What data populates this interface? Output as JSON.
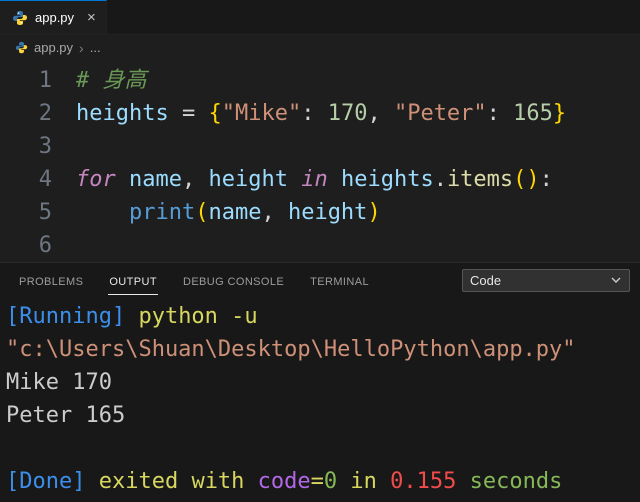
{
  "tabbar": {
    "tab": {
      "label": "app.py",
      "close": "×"
    }
  },
  "breadcrumb": {
    "file": "app.py",
    "sep": "›",
    "more": "..."
  },
  "editor": {
    "lines": [
      {
        "num": "1",
        "segments": [
          {
            "t": "# 身高",
            "c": "comment"
          }
        ]
      },
      {
        "num": "2",
        "segments": [
          {
            "t": "heights",
            "c": "var"
          },
          {
            "t": " = ",
            "c": "plain"
          },
          {
            "t": "{",
            "c": "brace"
          },
          {
            "t": "\"Mike\"",
            "c": "string"
          },
          {
            "t": ": ",
            "c": "plain"
          },
          {
            "t": "170",
            "c": "number"
          },
          {
            "t": ", ",
            "c": "plain"
          },
          {
            "t": "\"Peter\"",
            "c": "string"
          },
          {
            "t": ": ",
            "c": "plain"
          },
          {
            "t": "165",
            "c": "number"
          },
          {
            "t": "}",
            "c": "brace"
          }
        ]
      },
      {
        "num": "3",
        "segments": []
      },
      {
        "num": "4",
        "segments": [
          {
            "t": "for",
            "c": "keyword"
          },
          {
            "t": " ",
            "c": "plain"
          },
          {
            "t": "name",
            "c": "var"
          },
          {
            "t": ", ",
            "c": "plain"
          },
          {
            "t": "height",
            "c": "var"
          },
          {
            "t": " ",
            "c": "plain"
          },
          {
            "t": "in",
            "c": "keyword"
          },
          {
            "t": " ",
            "c": "plain"
          },
          {
            "t": "heights",
            "c": "var"
          },
          {
            "t": ".",
            "c": "plain"
          },
          {
            "t": "items",
            "c": "func"
          },
          {
            "t": "()",
            "c": "brace"
          },
          {
            "t": ":",
            "c": "plain"
          }
        ]
      },
      {
        "num": "5",
        "segments": [
          {
            "t": "    ",
            "c": "plain"
          },
          {
            "t": "print",
            "c": "builtin"
          },
          {
            "t": "(",
            "c": "brace"
          },
          {
            "t": "name",
            "c": "var"
          },
          {
            "t": ", ",
            "c": "plain"
          },
          {
            "t": "height",
            "c": "var"
          },
          {
            "t": ")",
            "c": "brace"
          }
        ]
      },
      {
        "num": "6",
        "segments": []
      }
    ]
  },
  "panel": {
    "tabs": [
      {
        "label": "PROBLEMS",
        "active": false
      },
      {
        "label": "OUTPUT",
        "active": true
      },
      {
        "label": "DEBUG CONSOLE",
        "active": false
      },
      {
        "label": "TERMINAL",
        "active": false
      }
    ],
    "dropdown": {
      "value": "Code"
    },
    "output_lines": [
      {
        "segments": [
          {
            "t": "[Running] ",
            "c": "blue"
          },
          {
            "t": "python -u",
            "c": "yellow"
          }
        ]
      },
      {
        "segments": [
          {
            "t": "\"c:\\Users\\Shuan\\Desktop\\HelloPython\\app.py\"",
            "c": "orange"
          }
        ]
      },
      {
        "segments": [
          {
            "t": "Mike 170",
            "c": "white"
          }
        ]
      },
      {
        "segments": [
          {
            "t": "Peter 165",
            "c": "white"
          }
        ]
      },
      {
        "segments": []
      },
      {
        "segments": [
          {
            "t": "[Done]",
            "c": "blue"
          },
          {
            "t": " exited with ",
            "c": "yellow"
          },
          {
            "t": "code",
            "c": "magenta"
          },
          {
            "t": "=",
            "c": "yellow"
          },
          {
            "t": "0",
            "c": "green"
          },
          {
            "t": " in ",
            "c": "yellow"
          },
          {
            "t": "0.155",
            "c": "red"
          },
          {
            "t": " seconds",
            "c": "green"
          }
        ]
      }
    ]
  },
  "colors": {
    "editor_background": "#1e1e1e",
    "panel_background": "#181818",
    "tab_bar_background": "#181818",
    "active_tab_accent": "#0078d4",
    "comment_green": "#6a9955",
    "string_orange": "#ce9178",
    "number_green": "#b5cea8",
    "keyword_purple": "#c586c0",
    "variable_blue": "#9cdcfe",
    "bracket_gold": "#ffd700",
    "info_blue": "#3b8eea",
    "error_red": "#f14c4c",
    "python_icon_blue": "#3776ab",
    "python_icon_yellow": "#ffd43b"
  }
}
